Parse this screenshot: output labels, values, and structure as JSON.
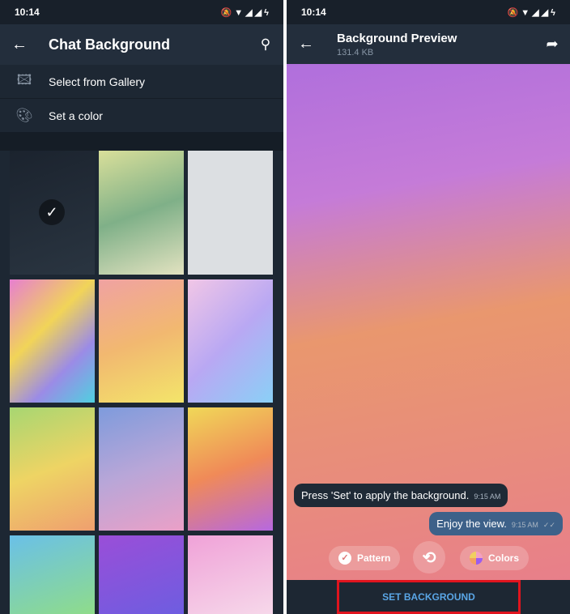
{
  "status_bar": {
    "time": "10:14"
  },
  "left": {
    "header": {
      "title": "Chat Background"
    },
    "menu": [
      {
        "label": "Select from Gallery",
        "icon": "image-icon"
      },
      {
        "label": "Set a color",
        "icon": "palette-icon"
      }
    ],
    "selected_tile": 0
  },
  "right": {
    "header": {
      "title": "Background Preview",
      "subtitle": "131.4 KB"
    },
    "messages": [
      {
        "text": "Press 'Set' to apply the background.",
        "time": "9:15 AM",
        "side": "incoming"
      },
      {
        "text": "Enjoy the view.",
        "time": "9:15 AM",
        "side": "outgoing",
        "status": "read"
      }
    ],
    "controls": {
      "pattern": "Pattern",
      "colors": "Colors"
    },
    "set_button": "SET BACKGROUND"
  }
}
